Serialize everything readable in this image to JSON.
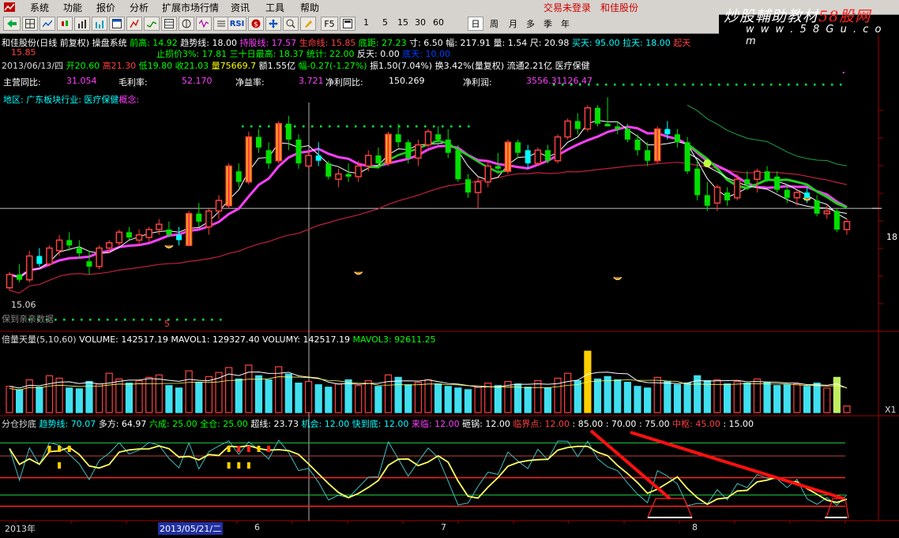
{
  "menu": {
    "items": [
      "系统",
      "功能",
      "报价",
      "分析",
      "扩展市场行情",
      "资讯",
      "工具",
      "帮助"
    ],
    "status": "交易未登录",
    "stock": "和佳股份"
  },
  "toolbar": {
    "labels": [
      "F5",
      "1",
      "5",
      "15",
      "30",
      "60",
      "日",
      "周",
      "月",
      "多",
      "季",
      "年"
    ],
    "rsi": "RSI"
  },
  "watermark": {
    "line1_a": "炒股輔助教材",
    "line1_b": "58股网",
    "line2": "w w w . 5 8 G u . c o m"
  },
  "info": {
    "line1": [
      {
        "text": "和佳股份(日线 前复权) 操盘系统 ",
        "color": "#ffffff"
      },
      {
        "text": "前高: 14.92 ",
        "color": "#00ff00"
      },
      {
        "text": "趋势线: 18.00 ",
        "color": "#ffffff"
      },
      {
        "text": "持股线: 17.57 ",
        "color": "#ff40ff"
      },
      {
        "text": "生命线: 15.85 ",
        "color": "#ff4040"
      },
      {
        "text": "底距: 27.23 ",
        "color": "#00ff00"
      },
      {
        "text": "寸: 6.50 ",
        "color": "#ffffff"
      },
      {
        "text": "幅: 217.91 ",
        "color": "#ffffff"
      },
      {
        "text": "量: 1.54 ",
        "color": "#ffffff"
      },
      {
        "text": "尺: 20.98 ",
        "color": "#ffffff"
      },
      {
        "text": "买天: 95.00 ",
        "color": "#00ffff"
      },
      {
        "text": "拉天: 18.00 ",
        "color": "#00ffff"
      },
      {
        "text": "起天",
        "color": "#ff4040"
      }
    ],
    "line2a": "15.85",
    "line2": [
      {
        "text": "止损价3%: 17.81 ",
        "color": "#00ff00"
      },
      {
        "text": "三十日最高: 18.37 ",
        "color": "#00ff00"
      },
      {
        "text": "统计: 22.00 ",
        "color": "#00ff00"
      },
      {
        "text": "反天: 0.00 ",
        "color": "#ffffff"
      },
      {
        "text": "底天: 10.00",
        "color": "#0040ff"
      }
    ],
    "line3": [
      {
        "text": "2013/06/13/四 ",
        "color": "#dddddd"
      },
      {
        "text": "开20.60 ",
        "color": "#00ff00"
      },
      {
        "text": "高21.30 ",
        "color": "#ff4040"
      },
      {
        "text": "低19.80 ",
        "color": "#00ff00"
      },
      {
        "text": "收21.03 ",
        "color": "#00ff00"
      },
      {
        "text": "量75669.7 ",
        "color": "#ffff00"
      },
      {
        "text": "额1.55亿 ",
        "color": "#ffffff"
      },
      {
        "text": "幅-0.27(-1.27%) ",
        "color": "#00ff00"
      },
      {
        "text": "振1.50(7.04%) ",
        "color": "#ffffff"
      },
      {
        "text": "换3.42%(量复权) ",
        "color": "#ffffff"
      },
      {
        "text": "流通2.21亿 ",
        "color": "#ffffff"
      },
      {
        "text": "医疗保健",
        "color": "#ffffff"
      }
    ],
    "fund": [
      {
        "label": "主营同比:",
        "value": "31.054"
      },
      {
        "label": "毛利率:",
        "value": "52.170"
      },
      {
        "label": "净益率:",
        "value": "3.721"
      },
      {
        "label": "净利同比:",
        "value": "150.269"
      },
      {
        "label": "净利润:",
        "value": "3556.31126.47"
      }
    ],
    "region": [
      {
        "text": "地区: ",
        "color": "#00ffff"
      },
      {
        "text": "广东板块",
        "color": "#00ffff"
      },
      {
        "text": "行业: ",
        "color": "#00ffff"
      },
      {
        "text": "医疗保健",
        "color": "#00ffff"
      },
      {
        "text": "概念: ",
        "color": "#ff40ff"
      }
    ]
  },
  "price_panel": {
    "price_line_label": "18",
    "low_label": "15.06",
    "ylim": [
      13.8,
      22.0
    ],
    "marker": "5",
    "bottom_text": "保到亲亲数据"
  },
  "volume_panel": {
    "title": [
      {
        "text": "倍量天量(5,10,60) ",
        "color": "#dddddd"
      },
      {
        "text": "VOLUME: 142517.19 ",
        "color": "#ffffff"
      },
      {
        "text": "MAVOL1: 129327.40 ",
        "color": "#ffffff"
      },
      {
        "text": "VOLUMY: 142517.19 ",
        "color": "#ffffff"
      },
      {
        "text": "MAVOL3: 92611.25",
        "color": "#00ff00"
      }
    ],
    "right_label": "X1"
  },
  "indicator_panel": {
    "title": [
      {
        "text": "分仓抄底 ",
        "color": "#dddddd"
      },
      {
        "text": "趋势线: 70.07 ",
        "color": "#00ffff"
      },
      {
        "text": "多方: 64.97 ",
        "color": "#ffffff"
      },
      {
        "text": "六成: 25.00 ",
        "color": "#00ff00"
      },
      {
        "text": "全仓: 25.00 ",
        "color": "#00ff00"
      },
      {
        "text": "超线: 23.73 ",
        "color": "#ffffff"
      },
      {
        "text": "机会: 12.00 ",
        "color": "#00ffff"
      },
      {
        "text": "快到底: 12.00 ",
        "color": "#00ffff"
      },
      {
        "text": "来临: 12.00 ",
        "color": "#ff40ff"
      },
      {
        "text": "砸锅: 12.00 ",
        "color": "#ffffff"
      },
      {
        "text": "临界点: 12.00 ",
        "color": "#ff4040"
      },
      {
        "text": ": 85.00 ",
        "color": "#ffffff"
      },
      {
        "text": ": 70.00 ",
        "color": "#ffffff"
      },
      {
        "text": ": 75.00 ",
        "color": "#ffffff"
      },
      {
        "text": "中枢: 45.00 ",
        "color": "#ff4040"
      },
      {
        "text": ": 15.00",
        "color": "#ffffff"
      }
    ]
  },
  "x_axis": {
    "year": "2013年",
    "cursor_date": "2013/05/21/二",
    "m6": "6",
    "m7": "7",
    "m8": "8"
  },
  "chart_data": {
    "type": "candlestick",
    "candles": [
      [
        15.0,
        15.6,
        14.9,
        15.5
      ],
      [
        15.5,
        15.9,
        15.2,
        15.3
      ],
      [
        15.3,
        16.4,
        15.2,
        16.2
      ],
      [
        16.2,
        16.5,
        15.8,
        15.9
      ],
      [
        15.9,
        16.6,
        15.8,
        16.5
      ],
      [
        16.4,
        17.0,
        16.2,
        16.8
      ],
      [
        16.8,
        17.1,
        16.4,
        16.6
      ],
      [
        16.5,
        16.8,
        16.1,
        16.3
      ],
      [
        16.0,
        16.4,
        15.5,
        15.8
      ],
      [
        15.8,
        16.6,
        15.7,
        16.5
      ],
      [
        16.5,
        16.8,
        16.3,
        16.7
      ],
      [
        16.7,
        17.2,
        16.6,
        17.1
      ],
      [
        17.1,
        17.3,
        16.8,
        16.9
      ],
      [
        16.8,
        17.2,
        16.6,
        17.0
      ],
      [
        16.9,
        17.3,
        16.7,
        17.2
      ],
      [
        17.2,
        17.6,
        17.0,
        17.4
      ],
      [
        17.2,
        17.5,
        16.9,
        17.0
      ],
      [
        17.0,
        17.3,
        16.6,
        16.8
      ],
      [
        16.6,
        17.9,
        16.6,
        17.8
      ],
      [
        17.8,
        18.2,
        17.3,
        17.5
      ],
      [
        17.3,
        18.0,
        17.0,
        17.9
      ],
      [
        17.9,
        18.5,
        17.6,
        18.3
      ],
      [
        18.1,
        19.7,
        18.0,
        19.6
      ],
      [
        19.4,
        19.7,
        18.8,
        19.0
      ],
      [
        19.0,
        20.9,
        18.9,
        20.7
      ],
      [
        20.7,
        21.0,
        20.1,
        20.3
      ],
      [
        20.2,
        20.5,
        19.5,
        19.7
      ],
      [
        19.8,
        21.3,
        19.7,
        21.2
      ],
      [
        21.2,
        21.5,
        20.2,
        20.6
      ],
      [
        20.6,
        20.8,
        19.5,
        19.7
      ],
      [
        19.6,
        20.2,
        19.5,
        20.0
      ],
      [
        20.0,
        20.5,
        19.6,
        19.8
      ],
      [
        19.7,
        19.8,
        19.1,
        19.2
      ],
      [
        19.1,
        19.5,
        18.8,
        19.3
      ],
      [
        19.3,
        19.7,
        19.0,
        19.2
      ],
      [
        19.2,
        19.8,
        19.0,
        19.6
      ],
      [
        19.6,
        20.2,
        19.4,
        20.0
      ],
      [
        20.0,
        20.3,
        19.5,
        19.7
      ],
      [
        19.7,
        20.9,
        19.6,
        20.8
      ],
      [
        20.8,
        21.2,
        20.3,
        20.5
      ],
      [
        20.5,
        20.6,
        19.7,
        19.9
      ],
      [
        19.9,
        20.6,
        19.6,
        20.4
      ],
      [
        20.4,
        21.0,
        20.3,
        20.9
      ],
      [
        20.8,
        21.1,
        20.4,
        20.6
      ],
      [
        20.6,
        21.0,
        19.9,
        20.1
      ],
      [
        20.2,
        20.4,
        19.0,
        19.1
      ],
      [
        19.1,
        19.3,
        18.4,
        18.6
      ],
      [
        18.6,
        19.2,
        18.0,
        19.0
      ],
      [
        19.0,
        19.8,
        18.8,
        19.6
      ],
      [
        19.6,
        20.1,
        19.3,
        19.5
      ],
      [
        19.4,
        20.6,
        19.3,
        20.5
      ],
      [
        20.5,
        20.6,
        19.9,
        20.1
      ],
      [
        20.2,
        20.4,
        19.5,
        19.7
      ],
      [
        19.7,
        20.3,
        19.6,
        20.2
      ],
      [
        20.2,
        20.4,
        19.7,
        19.8
      ],
      [
        19.8,
        20.8,
        19.7,
        20.7
      ],
      [
        20.7,
        21.4,
        20.6,
        21.3
      ],
      [
        21.3,
        21.6,
        20.8,
        21.0
      ],
      [
        21.0,
        21.9,
        20.9,
        21.8
      ],
      [
        21.8,
        21.9,
        21.1,
        21.2
      ],
      [
        21.2,
        22.2,
        21.1,
        21.1
      ],
      [
        21.1,
        21.3,
        20.8,
        21.0
      ],
      [
        21.0,
        21.2,
        20.5,
        20.6
      ],
      [
        20.6,
        20.8,
        20.0,
        20.2
      ],
      [
        20.2,
        20.5,
        19.6,
        19.8
      ],
      [
        19.8,
        21.1,
        19.7,
        21.0
      ],
      [
        21.0,
        21.3,
        20.6,
        20.8
      ],
      [
        20.8,
        21.0,
        20.3,
        20.5
      ],
      [
        20.5,
        20.7,
        19.3,
        19.4
      ],
      [
        19.5,
        19.8,
        18.3,
        18.5
      ],
      [
        18.5,
        19.0,
        17.9,
        18.1
      ],
      [
        18.2,
        18.9,
        17.9,
        18.8
      ],
      [
        18.6,
        18.8,
        18.1,
        18.3
      ],
      [
        18.4,
        19.3,
        18.3,
        19.1
      ],
      [
        19.1,
        19.4,
        18.7,
        18.9
      ],
      [
        19.1,
        19.5,
        18.6,
        19.4
      ],
      [
        19.4,
        19.6,
        19.0,
        19.1
      ],
      [
        19.2,
        19.4,
        18.6,
        18.7
      ],
      [
        18.7,
        18.9,
        18.2,
        18.4
      ],
      [
        18.4,
        18.7,
        18.1,
        18.6
      ],
      [
        18.6,
        18.8,
        18.2,
        18.3
      ],
      [
        18.3,
        18.5,
        17.7,
        17.8
      ],
      [
        17.8,
        18.1,
        17.6,
        17.9
      ],
      [
        17.9,
        18.0,
        17.1,
        17.2
      ],
      [
        17.2,
        17.6,
        17.0,
        17.5
      ]
    ],
    "volumes": [
      3.2,
      2.8,
      4.0,
      3.1,
      4.5,
      4.2,
      3.0,
      2.9,
      3.8,
      3.5,
      4.8,
      4.1,
      3.6,
      3.9,
      4.3,
      4.6,
      3.3,
      3.0,
      5.1,
      3.7,
      4.4,
      4.9,
      5.5,
      4.1,
      5.8,
      4.5,
      4.0,
      5.6,
      4.7,
      3.6,
      3.8,
      3.4,
      3.1,
      3.5,
      4.0,
      3.3,
      3.9,
      3.2,
      4.6,
      4.3,
      3.4,
      3.7,
      4.0,
      3.5,
      3.2,
      3.0,
      2.8,
      3.1,
      3.6,
      3.3,
      3.8,
      3.5,
      3.1,
      3.9,
      3.0,
      4.2,
      4.8,
      3.9,
      7.5,
      4.1,
      4.4,
      4.0,
      3.7,
      3.2,
      3.0,
      4.3,
      3.8,
      3.4,
      3.6,
      4.5,
      3.9,
      4.0,
      3.5,
      3.8,
      3.6,
      4.1,
      3.7,
      3.3,
      3.4,
      3.5,
      3.2,
      3.6,
      3.0,
      4.3,
      0.8
    ],
    "ylim": [
      13.8,
      22.0
    ]
  }
}
